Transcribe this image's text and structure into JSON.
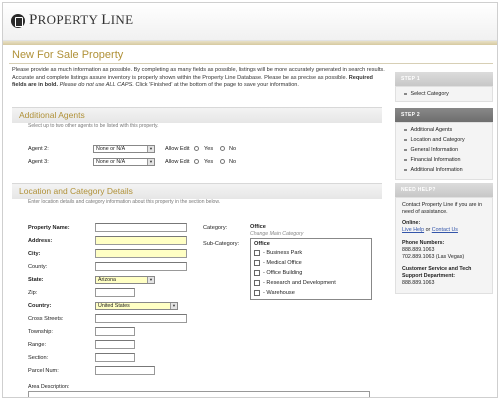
{
  "brand": {
    "logo_first": "P",
    "logo_rest": "ROPERTY ",
    "logo_last_first": "L",
    "logo_last_rest": "INE"
  },
  "page": {
    "title": "New For Sale Property",
    "intro_1": "Please provide as much information as possible. By completing as many fields as possible, listings will be more accurately generated in search results. Accurate and complete listings assure inventory is properly shown within the Property Line Database. Please be as precise as possible. ",
    "intro_bold": "Required fields are in bold.",
    "intro_italic": " Please do not use ALL CAPS.",
    "intro_2": " Click 'Finished' at the bottom of the page to save your information."
  },
  "agents": {
    "title": "Additional Agents",
    "subtitle": "Select up to two other agents to be listed with this property.",
    "rows": [
      {
        "label": "Agent 2:",
        "select": "None or N/A",
        "allow_edit": "Allow Edit",
        "yes": "Yes",
        "no": "No"
      },
      {
        "label": "Agent 3:",
        "select": "None or N/A",
        "allow_edit": "Allow Edit",
        "yes": "Yes",
        "no": "No"
      }
    ]
  },
  "location": {
    "title": "Location and Category Details",
    "subtitle": "Enter location details and category information about this property in the section below.",
    "fields": {
      "property_name": "Property Name:",
      "address": "Address:",
      "city": "City:",
      "county": "County:",
      "state": "State:",
      "state_value": "Arizona",
      "zip": "Zip:",
      "country": "Country:",
      "country_value": "United States",
      "cross_streets": "Cross Streets:",
      "township": "Township:",
      "range": "Range:",
      "section": "Section:",
      "parcel_num": "Parcel Num:",
      "area_description": "Area Description:"
    },
    "category_label": "Category:",
    "category_value": "Office",
    "change_category": "Change Main Category",
    "subcategory_label": "Sub-Category:",
    "subcategory_head": "Office",
    "subcategories": [
      "- Business Park",
      "- Medical Office",
      "- Office Building",
      "- Research and Development",
      "- Warehouse"
    ]
  },
  "sidebar": {
    "step1_head": "STEP 1",
    "step1_items": [
      "Select Category"
    ],
    "step2_head": "STEP 2",
    "step2_items": [
      "Additional Agents",
      "Location and Category",
      "General Information",
      "Financial Information",
      "Additional Information"
    ],
    "help_head": "NEED HELP?",
    "help_intro": "Contact Property Line if you are in need of assistance.",
    "online_label": "Online:",
    "live_help": "Live Help",
    "or": " or ",
    "contact_us": "Contact Us",
    "phone_label": "Phone Numbers:",
    "phone_1": "888.889.1063",
    "phone_2": "702.889.1063 (Las Vegas)",
    "support_label": "Customer Service and Tech Support Department:",
    "support_phone": "888.889.1063"
  }
}
